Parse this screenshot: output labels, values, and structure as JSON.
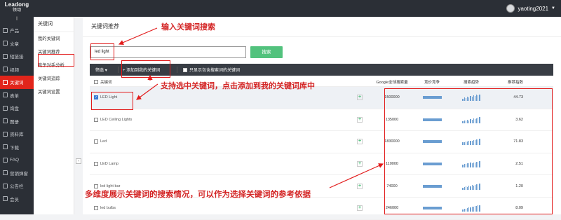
{
  "brand": {
    "name": "Leadong",
    "sub": "领动"
  },
  "user": {
    "name": "yaoting2021"
  },
  "sidebar": {
    "items": [
      {
        "label": "产品"
      },
      {
        "label": "文章"
      },
      {
        "label": "短链接"
      },
      {
        "label": "视频"
      },
      {
        "label": "关键词",
        "active": true
      },
      {
        "label": "表单"
      },
      {
        "label": "询盘"
      },
      {
        "label": "图册"
      },
      {
        "label": "资料库"
      },
      {
        "label": "下载"
      },
      {
        "label": "FAQ"
      },
      {
        "label": "营销弹窗"
      },
      {
        "label": "公告栏"
      },
      {
        "label": "会员"
      }
    ]
  },
  "subnav": {
    "title": "关键词",
    "items": [
      "我的关键词",
      "关键词推荐",
      "竞争对手分析",
      "关键词追踪",
      "关键词设置"
    ]
  },
  "main": {
    "title": "关键词推荐",
    "search": {
      "value": "led light",
      "button": "搜索"
    },
    "toolbar": {
      "filter": "筛选",
      "add": "+ 添加到我的关键词",
      "show_only": "只显示包含搜索词的关键词"
    },
    "headers": {
      "keyword": "关键词",
      "volume": "Google全球搜索量",
      "competition": "竞价竞争",
      "trend": "搜索趋势",
      "index": "推荐指数"
    },
    "rows": [
      {
        "keyword": "LED Light",
        "checked": true,
        "volume": "1500000",
        "competition": 0.9,
        "index": "44.73",
        "trend": [
          3,
          5,
          4,
          6,
          5,
          7,
          6,
          8,
          7,
          9,
          8,
          9
        ]
      },
      {
        "keyword": "LED Ceiling Lights",
        "checked": false,
        "volume": "135000",
        "competition": 0.9,
        "index": "3.62",
        "trend": [
          3,
          4,
          4,
          5,
          4,
          6,
          5,
          7,
          6,
          7,
          8,
          9
        ]
      },
      {
        "keyword": "Led",
        "checked": false,
        "volume": "1830000",
        "competition": 0.9,
        "index": "71.83",
        "trend": [
          4,
          4,
          5,
          5,
          6,
          6,
          6,
          7,
          7,
          8,
          8,
          9
        ]
      },
      {
        "keyword": "LED Lamp",
        "checked": false,
        "volume": "110000",
        "competition": 0.9,
        "index": "2.51",
        "trend": [
          4,
          5,
          5,
          6,
          6,
          7,
          6,
          7,
          7,
          8,
          8,
          9
        ]
      },
      {
        "keyword": "led light bar",
        "checked": false,
        "volume": "74000",
        "competition": 0.9,
        "index": "1.20",
        "trend": [
          3,
          4,
          5,
          4,
          6,
          5,
          7,
          6,
          7,
          8,
          8,
          9
        ]
      },
      {
        "keyword": "led bulbs",
        "checked": false,
        "volume": "246000",
        "competition": 0.9,
        "index": "8.09",
        "trend": [
          3,
          4,
          4,
          5,
          6,
          6,
          7,
          7,
          8,
          8,
          9,
          9
        ]
      }
    ]
  },
  "annotations": {
    "note1": "输入关键词搜索",
    "note2": "支持选中关键词，点击添加到我的关键词库中",
    "note3": "多维度展示关键词的搜索情况，可以作为选择关键词的参考依据"
  }
}
